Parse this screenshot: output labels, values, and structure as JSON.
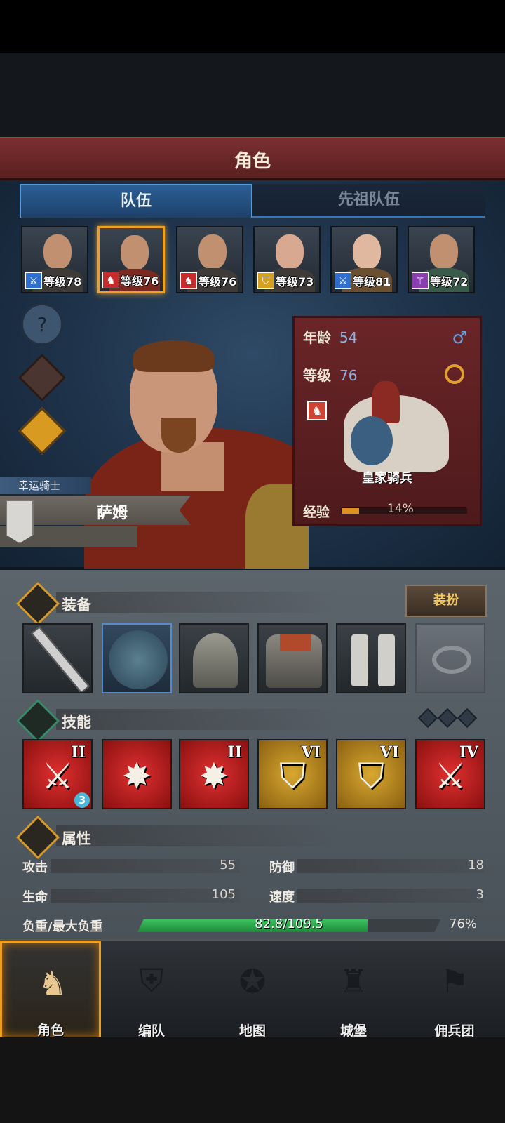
{
  "header": {
    "title": "角色"
  },
  "tabs": [
    {
      "label": "队伍",
      "active": true
    },
    {
      "label": "先祖队伍",
      "active": false
    }
  ],
  "party": [
    {
      "level_label": "等级78",
      "class_icon": "sword-icon",
      "class_color": "#2f6fd0",
      "selected": false
    },
    {
      "level_label": "等级76",
      "class_icon": "horse-icon",
      "class_color": "#c62c2c",
      "selected": true
    },
    {
      "level_label": "等级76",
      "class_icon": "horse-icon",
      "class_color": "#c62c2c",
      "selected": false
    },
    {
      "level_label": "等级73",
      "class_icon": "shield-icon",
      "class_color": "#d8a020",
      "selected": false
    },
    {
      "level_label": "等级81",
      "class_icon": "sword-icon",
      "class_color": "#2f6fd0",
      "selected": false
    },
    {
      "level_label": "等级72",
      "class_icon": "staff-icon",
      "class_color": "#8a3fb0",
      "selected": false
    }
  ],
  "hero": {
    "title": "幸运骑士",
    "name": "萨姆"
  },
  "info": {
    "age_label": "年龄",
    "age": "54",
    "level_label": "等级",
    "level": "76",
    "unit_name": "皇家骑兵",
    "exp_label": "经验",
    "exp_pct": "14%",
    "exp_fraction": 0.14
  },
  "equipment": {
    "title": "装备",
    "dress_button": "装扮",
    "slots": [
      "sword-icon",
      "plume-icon",
      "helmet-icon",
      "armor-icon",
      "boots-icon",
      "ring-icon"
    ]
  },
  "skills": {
    "title": "技能",
    "items": [
      {
        "icon": "sword-icon",
        "rank": "II",
        "badge": "3",
        "style": "red"
      },
      {
        "icon": "impact-icon",
        "rank": "",
        "badge": "",
        "style": "red"
      },
      {
        "icon": "impact-icon",
        "rank": "II",
        "badge": "",
        "style": "red"
      },
      {
        "icon": "shield-icon",
        "rank": "VI",
        "badge": "",
        "style": "gold"
      },
      {
        "icon": "shield-icon",
        "rank": "VI",
        "badge": "",
        "style": "gold"
      },
      {
        "icon": "sword-icon",
        "rank": "IV",
        "badge": "",
        "style": "red"
      }
    ]
  },
  "attributes": {
    "title": "属性",
    "attack_label": "攻击",
    "attack": "55",
    "defense_label": "防御",
    "defense": "18",
    "hp_label": "生命",
    "hp": "105",
    "speed_label": "速度",
    "speed": "3",
    "weight_label": "负重/最大负重",
    "weight_text": "82.8/109.5",
    "weight_pct": "76%",
    "weight_fraction": 0.76
  },
  "nav": [
    {
      "label": "角色",
      "icon": "knight-icon",
      "active": true
    },
    {
      "label": "编队",
      "icon": "formation-icon",
      "active": false
    },
    {
      "label": "地图",
      "icon": "compass-icon",
      "active": false
    },
    {
      "label": "城堡",
      "icon": "castle-icon",
      "active": false
    },
    {
      "label": "佣兵团",
      "icon": "banner-icon",
      "active": false
    }
  ]
}
